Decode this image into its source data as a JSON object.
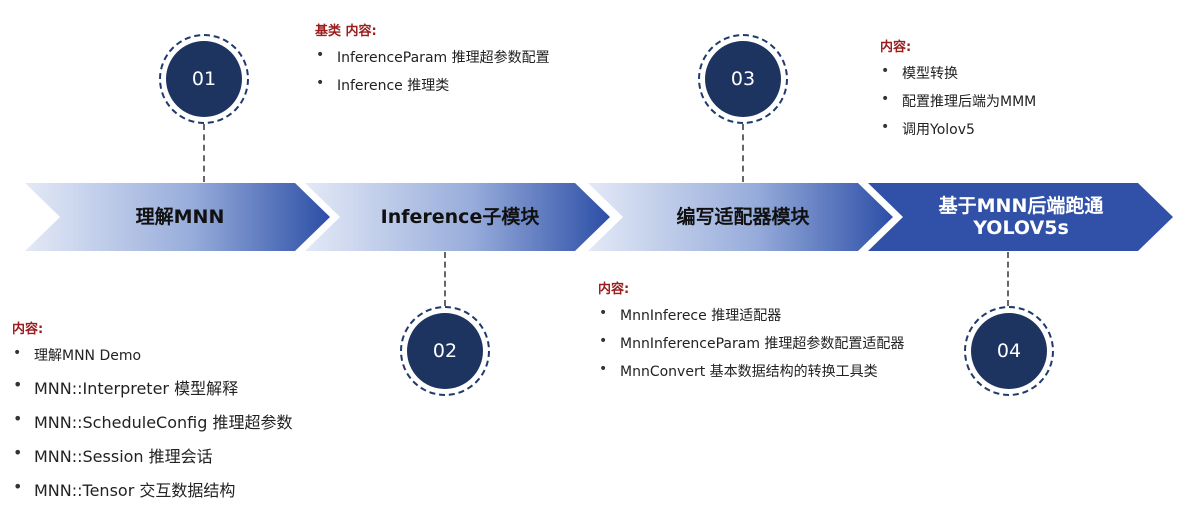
{
  "stages": [
    {
      "number": "01",
      "arrow_label": "理解MNN"
    },
    {
      "number": "02",
      "arrow_label": "Inference子模块"
    },
    {
      "number": "03",
      "arrow_label": "编写适配器模块"
    },
    {
      "number": "04",
      "arrow_label_line1": "基于MNN后端跑通",
      "arrow_label_line2": "YOLOV5s"
    }
  ],
  "details": {
    "stage1": {
      "title": "内容:",
      "items": [
        "理解MNN Demo",
        "MNN::Interpreter 模型解释",
        "MNN::ScheduleConfig 推理超参数",
        "MNN::Session 推理会话",
        "MNN::Tensor 交互数据结构"
      ]
    },
    "stage2": {
      "title": "基类 内容:",
      "items": [
        "InferenceParam 推理超参数配置",
        "Inference 推理类"
      ]
    },
    "stage3": {
      "title": "内容:",
      "items": [
        "MnnInferece 推理适配器",
        "MnnInferenceParam 推理超参数配置适配器",
        "MnnConvert 基本数据结构的转换工具类"
      ]
    },
    "stage4": {
      "title": "内容:",
      "items": [
        "模型转换",
        "配置推理后端为MMM",
        "调用Yolov5"
      ]
    }
  },
  "colors": {
    "arrow_light": "#dfe6f4",
    "arrow_dark": "#2f50a6",
    "arrow_last": "#3150a8",
    "circle_fill": "#1d3461",
    "detail_title": "#9a1c1c"
  }
}
